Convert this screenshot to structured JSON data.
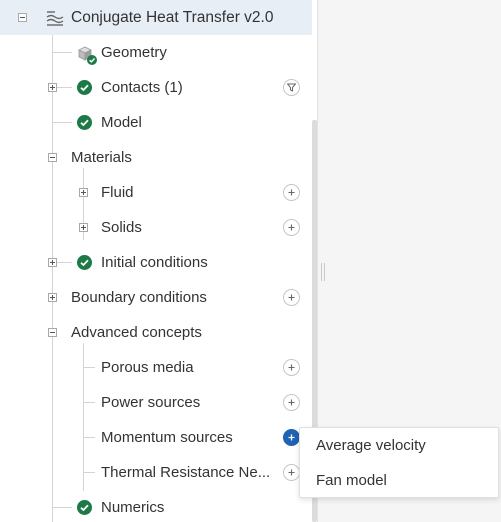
{
  "tree": {
    "root": {
      "label": "Conjugate Heat Transfer v2.0",
      "icon": "simulation-icon"
    },
    "geometry": {
      "label": "Geometry",
      "icon": "geometry-cube-icon"
    },
    "contacts": {
      "label": "Contacts (1)",
      "icon": "filter-icon"
    },
    "model": {
      "label": "Model"
    },
    "materials": {
      "label": "Materials"
    },
    "fluid": {
      "label": "Fluid"
    },
    "solids": {
      "label": "Solids"
    },
    "initial_conditions": {
      "label": "Initial conditions"
    },
    "boundary_conditions": {
      "label": "Boundary conditions"
    },
    "advanced_concepts": {
      "label": "Advanced concepts"
    },
    "porous_media": {
      "label": "Porous media"
    },
    "power_sources": {
      "label": "Power sources"
    },
    "momentum_sources": {
      "label": "Momentum sources"
    },
    "thermal_resistance": {
      "label": "Thermal Resistance Ne..."
    },
    "numerics": {
      "label": "Numerics"
    }
  },
  "context_menu": {
    "items": [
      "Average velocity",
      "Fan model"
    ]
  },
  "colors": {
    "selected_row": "#e7eef6",
    "check_green": "#1b7a46",
    "active_button": "#1e63b4"
  }
}
